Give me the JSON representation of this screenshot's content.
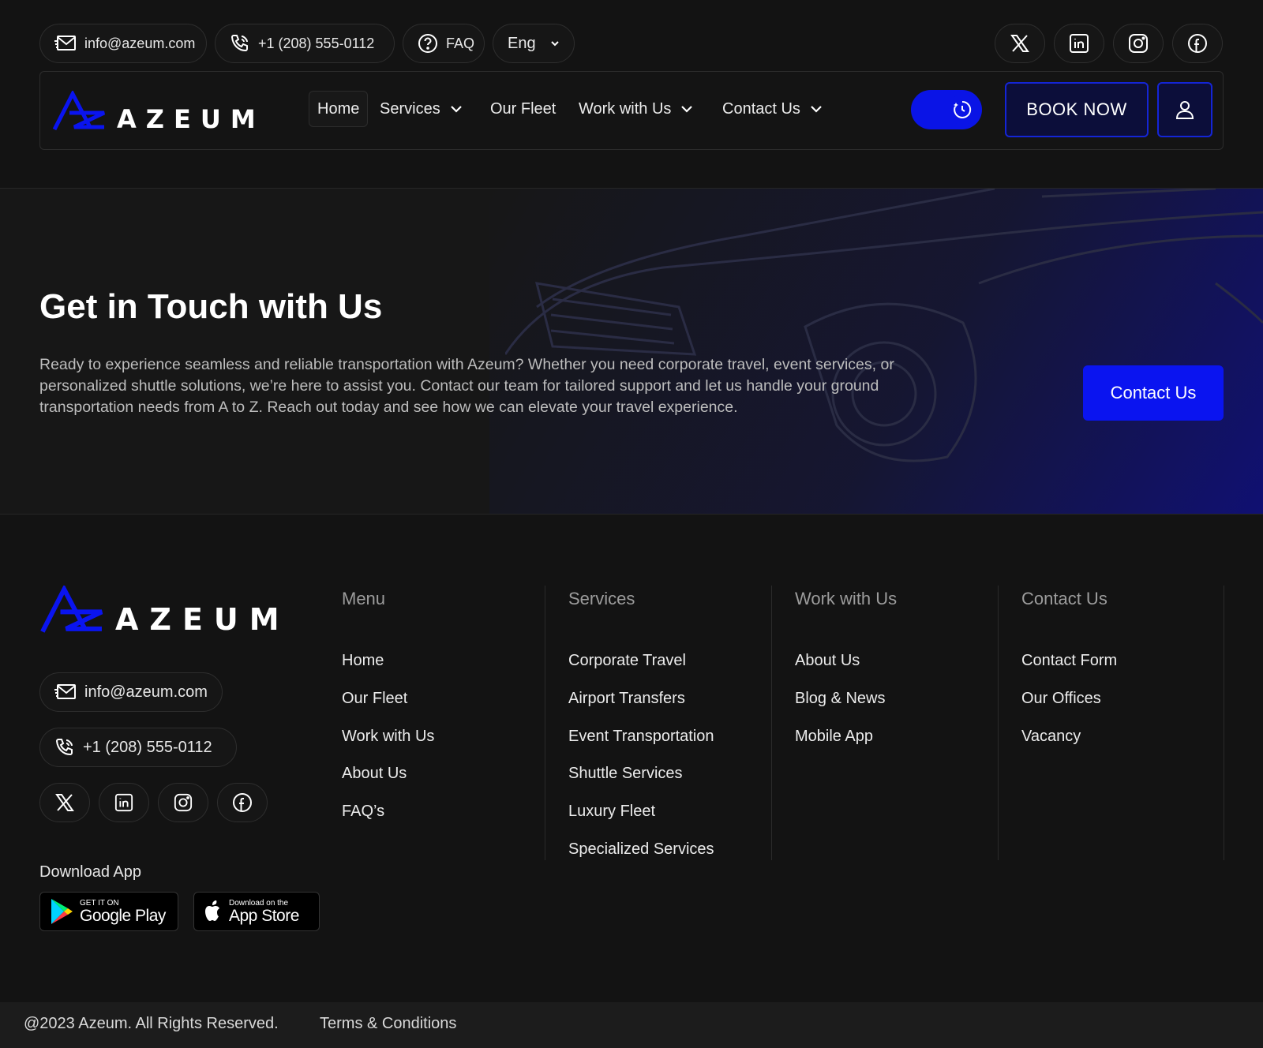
{
  "topbar": {
    "email": "info@azeum.com",
    "phone": "+1 (208) 555-0112",
    "faq": "FAQ",
    "language": "Eng",
    "social_icons": [
      "x-icon",
      "linkedin-icon",
      "instagram-icon",
      "facebook-icon"
    ]
  },
  "brand": {
    "name": "AZEUM",
    "accent_color": "#0a14f0"
  },
  "nav": {
    "items": [
      {
        "label": "Home",
        "active": true,
        "dropdown": false
      },
      {
        "label": "Services",
        "active": false,
        "dropdown": true
      },
      {
        "label": "Our Fleet",
        "active": false,
        "dropdown": false
      },
      {
        "label": "Work with Us",
        "active": false,
        "dropdown": true
      },
      {
        "label": "Contact Us",
        "active": false,
        "dropdown": true
      }
    ],
    "book_now": "BOOK NOW"
  },
  "hero": {
    "title": "Get in Touch with Us",
    "text": "Ready to experience seamless and reliable transportation with Azeum? Whether you need corporate travel, event services, or personalized shuttle solutions, we’re here to assist you. Contact our team for tailored support and let us handle your ground transportation needs from A to Z. Reach out today and see how we can elevate your travel experience.",
    "button": "Contact Us"
  },
  "footer": {
    "email": "info@azeum.com",
    "phone": "+1 (208) 555-0112",
    "download_label": "Download App",
    "google_play": {
      "small": "GET IT ON",
      "big": "Google Play"
    },
    "app_store": {
      "small": "Download on the",
      "big": "App Store"
    },
    "columns": [
      {
        "title": "Menu",
        "links": [
          "Home",
          "Our Fleet",
          "Work with Us",
          "About Us",
          "FAQ’s"
        ]
      },
      {
        "title": "Services",
        "links": [
          "Corporate Travel",
          "Airport Transfers",
          "Event Transportation",
          "Shuttle Services",
          "Luxury Fleet",
          "Specialized Services"
        ]
      },
      {
        "title": "Work with Us",
        "links": [
          "About Us",
          "Blog & News",
          "Mobile App"
        ]
      },
      {
        "title": "Contact Us",
        "links": [
          "Contact Form",
          "Our Offices",
          "Vacancy"
        ]
      }
    ],
    "copyright": "@2023 Azeum. All Rights Reserved.",
    "terms": "Terms & Conditions"
  }
}
